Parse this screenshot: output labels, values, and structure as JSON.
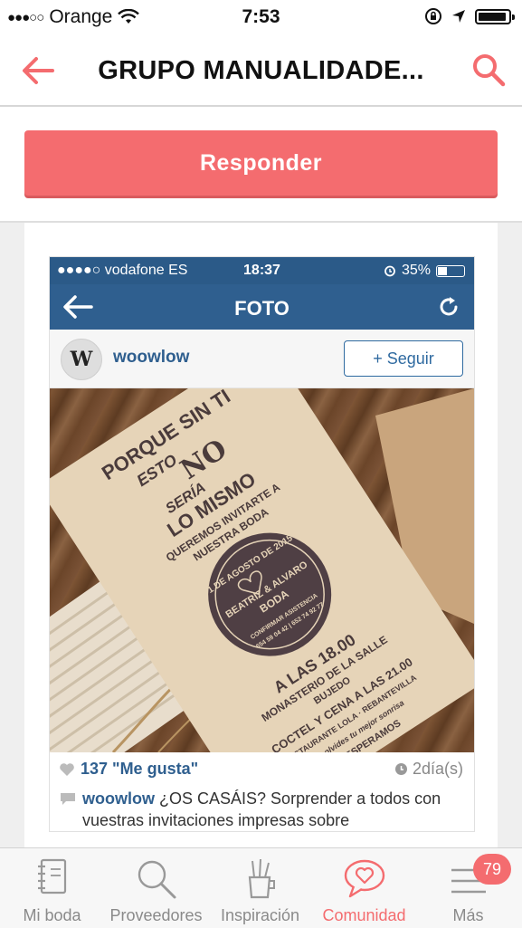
{
  "status_bar": {
    "carrier": "Orange",
    "time": "7:53"
  },
  "nav": {
    "title": "GRUPO MANUALIDADE..."
  },
  "reply": {
    "label": "Responder"
  },
  "post": {
    "screenshot": {
      "status": {
        "carrier": "vodafone ES",
        "time": "18:37",
        "battery": "35%"
      },
      "nav_title": "FOTO",
      "username": "woowlow",
      "avatar_letter": "W",
      "follow_label": "+ Seguir",
      "photo": {
        "line1": "PORQUE SIN TI",
        "line2": "ESTO",
        "line3": "NO",
        "line4": "SERÍA",
        "line5": "LO MISMO",
        "line6": "QUEREMOS INVITARTE A",
        "line7": "NUESTRA BODA",
        "seal_date": "1 DE AGOSTO DE 2015",
        "seal_names": "BEATRIZ & ALVARO",
        "seal_boda": "BODA",
        "seal_confirm": "CONFIRMAR ASISTENCIA",
        "seal_phones": "654 59 04 42 | 652 74 92 77",
        "detail1": "A LAS 18.00",
        "detail2": "MONASTERIO DE LA SALLE",
        "detail3": "BUJEDO",
        "detail4": "COCTEL Y CENA A LAS 21.00",
        "detail5": "RESTAURANTE LOLA · REBANTEVILLA",
        "detail6": "No olvides tu mejor sonrisa",
        "detail7": "TE ESPERAMOS"
      },
      "likes": "137 \"Me gusta\"",
      "age": "2día(s)",
      "caption_user": "woowlow",
      "caption_text": "¿OS CASÁIS? Sorprender a todos con vuestras invitaciones impresas sobre"
    }
  },
  "tabs": [
    {
      "label": "Mi boda",
      "icon": "notebook-icon"
    },
    {
      "label": "Proveedores",
      "icon": "search-icon"
    },
    {
      "label": "Inspiración",
      "icon": "craft-cup-icon"
    },
    {
      "label": "Comunidad",
      "icon": "speech-heart-icon"
    },
    {
      "label": "Más",
      "icon": "menu-icon",
      "badge": "79"
    }
  ],
  "colors": {
    "accent": "#f46c6f",
    "instagram_blue": "#2f5f8f"
  }
}
